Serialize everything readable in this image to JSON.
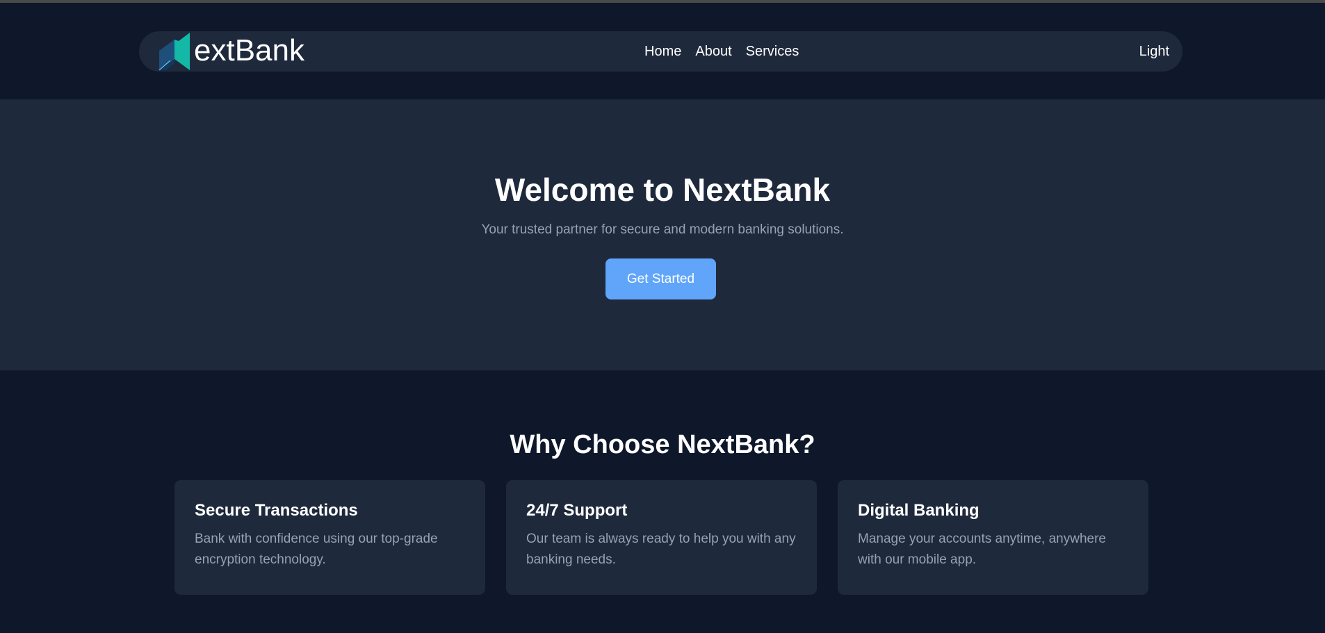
{
  "brand": {
    "logo_text": "extBank",
    "colors": {
      "page_bg": "#0f172a",
      "surface": "#1e293b",
      "accent": "#60a5fa",
      "logo_teal": "#14b8a6",
      "logo_blue": "#1e4f7a",
      "muted_text": "#94a3b8"
    }
  },
  "nav": {
    "links": [
      {
        "label": "Home"
      },
      {
        "label": "About"
      },
      {
        "label": "Services"
      }
    ],
    "theme_toggle_label": "Light"
  },
  "hero": {
    "title": "Welcome to NextBank",
    "subtitle": "Your trusted partner for secure and modern banking solutions.",
    "cta_label": "Get Started"
  },
  "features": {
    "title": "Why Choose NextBank?",
    "cards": [
      {
        "title": "Secure Transactions",
        "text": "Bank with confidence using our top-grade encryption technology."
      },
      {
        "title": "24/7 Support",
        "text": "Our team is always ready to help you with any banking needs."
      },
      {
        "title": "Digital Banking",
        "text": "Manage your accounts anytime, anywhere with our mobile app."
      }
    ]
  }
}
